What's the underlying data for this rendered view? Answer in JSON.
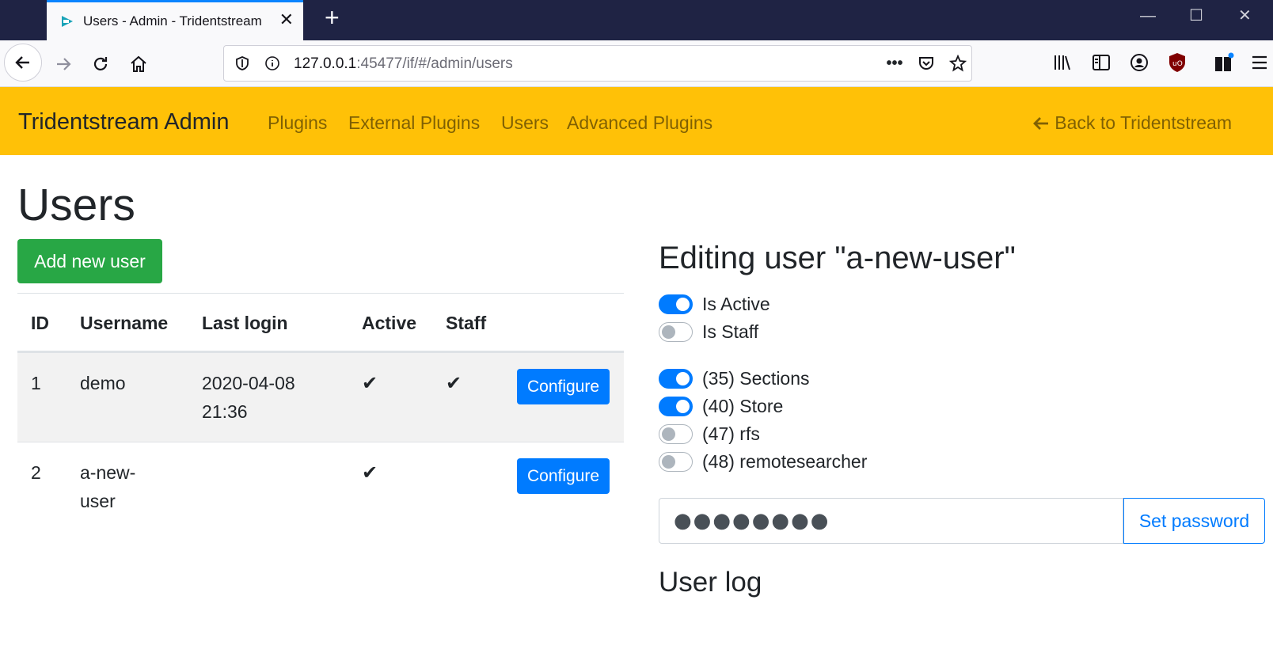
{
  "browser": {
    "tab_title": "Users - Admin - Tridentstream",
    "url_host": "127.0.0.1",
    "url_rest": ":45477/if/#/admin/users"
  },
  "nav": {
    "brand": "Tridentstream Admin",
    "links": [
      "Plugins",
      "External Plugins",
      "Users",
      "Advanced Plugins"
    ],
    "back": "Back to Tridentstream"
  },
  "page": {
    "title": "Users",
    "add_button": "Add new user"
  },
  "table": {
    "headers": [
      "ID",
      "Username",
      "Last login",
      "Active",
      "Staff"
    ],
    "rows": [
      {
        "id": "1",
        "username": "demo",
        "last_login_date": "2020-04-08",
        "last_login_time": "21:36",
        "active": true,
        "staff": true,
        "action": "Configure"
      },
      {
        "id": "2",
        "username_1": "a-new-",
        "username_2": "user",
        "last_login_date": "",
        "active": true,
        "staff": false,
        "action": "Configure"
      }
    ]
  },
  "editor": {
    "title": "Editing user \"a-new-user\"",
    "is_active_label": "Is Active",
    "is_active": true,
    "is_staff_label": "Is Staff",
    "is_staff": false,
    "permissions": [
      {
        "label": "(35) Sections",
        "on": true
      },
      {
        "label": "(40) Store",
        "on": true
      },
      {
        "label": "(47) rfs",
        "on": false
      },
      {
        "label": "(48) remotesearcher",
        "on": false
      }
    ],
    "password_value": "●●●●●●●●",
    "set_password": "Set password",
    "log_title": "User log"
  },
  "colors": {
    "navbar": "#ffc107",
    "success": "#28a745",
    "primary": "#007bff"
  }
}
